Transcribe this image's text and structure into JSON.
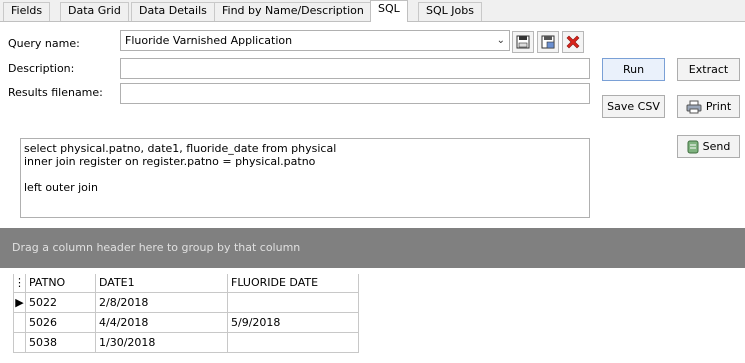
{
  "tabs": [
    {
      "label": "Fields",
      "active": false
    },
    {
      "label": "Data Grid",
      "active": false
    },
    {
      "label": "Data Details",
      "active": false
    },
    {
      "label": "Find by Name/Description",
      "active": false
    },
    {
      "label": "SQL",
      "active": true
    },
    {
      "label": "SQL Jobs",
      "active": false
    }
  ],
  "form": {
    "query_name_label": "Query name:",
    "query_name_value": "Fluoride Varnished Application",
    "description_label": "Description:",
    "description_value": "",
    "results_filename_label": "Results filename:",
    "results_filename_value": ""
  },
  "buttons": {
    "run": "Run",
    "extract": "Extract",
    "save_csv": "Save CSV",
    "print": "Print",
    "send": "Send"
  },
  "sql_text": "select physical.patno, date1, fluoride_date from physical\ninner join register on register.patno = physical.patno\n\nleft outer join",
  "group_bar_text": "Drag a column header here to group by that column",
  "grid": {
    "columns": [
      "PATNO",
      "DATE1",
      "FLUORIDE DATE"
    ],
    "rows": [
      {
        "patno": "5022",
        "date1": "2/8/2018",
        "fluoride_date": ""
      },
      {
        "patno": "5026",
        "date1": "4/4/2018",
        "fluoride_date": "5/9/2018"
      },
      {
        "patno": "5038",
        "date1": "1/30/2018",
        "fluoride_date": ""
      }
    ]
  },
  "icons": {
    "save": "save-icon",
    "save_as": "save-as-icon",
    "delete": "delete-icon",
    "printer": "printer-icon",
    "send": "send-icon"
  },
  "colors": {
    "group_bar": "#808080",
    "delete_red": "#d9231b"
  }
}
